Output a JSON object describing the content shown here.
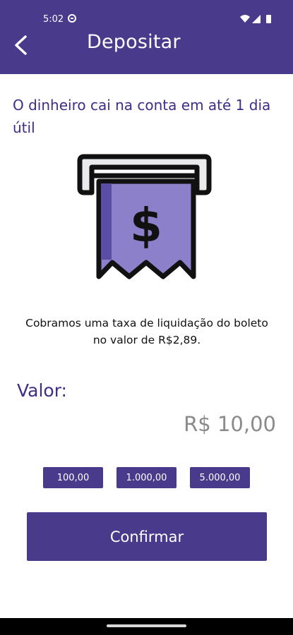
{
  "status_bar": {
    "time": "5:02"
  },
  "header": {
    "title": "Depositar"
  },
  "main": {
    "headline": "O dinheiro cai na conta em até 1 dia útil",
    "fee_note": "Cobramos uma taxa de liquidação do boleto no valor de R$2,89.",
    "valor_label": "Valor:",
    "amount": "R$ 10,00",
    "quick_amounts": [
      "100,00",
      "1.000,00",
      "5.000,00"
    ],
    "confirm_label": "Confirmar",
    "illustration_symbol": "$"
  },
  "icons": {
    "back": "arrow-left-icon",
    "illustration": "atm-receipt-icon",
    "status": [
      "do-not-disturb-icon",
      "wifi-icon",
      "signal-icon",
      "battery-icon"
    ]
  },
  "colors": {
    "primary": "#4a3a8c",
    "accent": "#8b80c9",
    "text_primary": "#3f2d86"
  }
}
